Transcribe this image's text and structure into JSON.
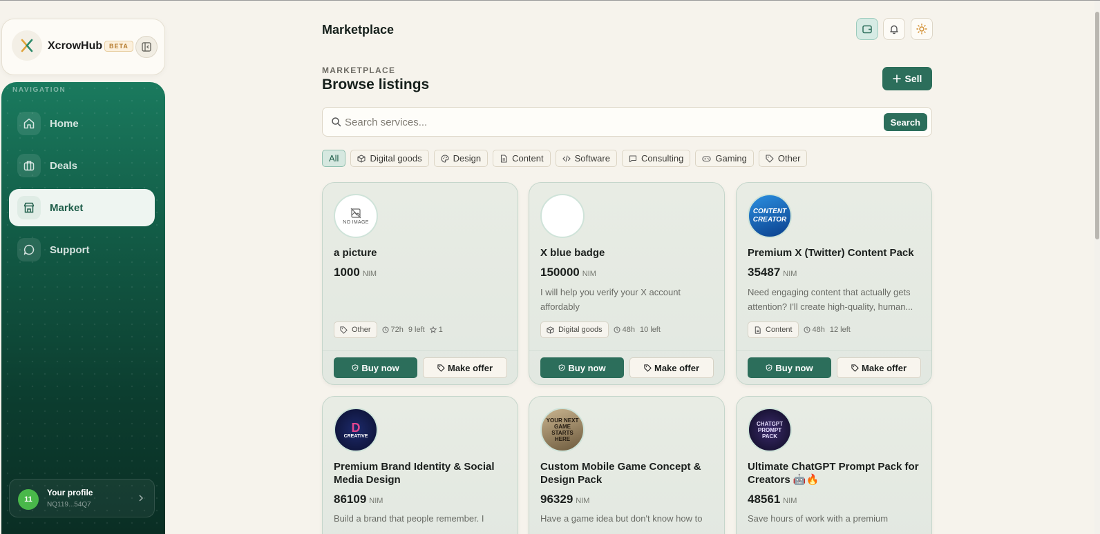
{
  "brand": {
    "name": "XcrowHub",
    "badge": "BETA"
  },
  "nav": {
    "heading": "NAVIGATION",
    "items": [
      {
        "label": "Home",
        "icon": "home-icon"
      },
      {
        "label": "Deals",
        "icon": "briefcase-icon"
      },
      {
        "label": "Market",
        "icon": "store-icon",
        "active": true
      },
      {
        "label": "Support",
        "icon": "chat-bubble-icon"
      }
    ]
  },
  "profile": {
    "initials": "11",
    "name": "Your profile",
    "address": "NQ119...54Q7"
  },
  "header": {
    "title": "Marketplace"
  },
  "section": {
    "eyebrow": "MARKETPLACE",
    "title": "Browse listings",
    "sell_label": "Sell"
  },
  "search": {
    "placeholder": "Search services...",
    "button": "Search"
  },
  "filters": [
    {
      "label": "All",
      "active": true
    },
    {
      "label": "Digital goods",
      "icon": "box-icon"
    },
    {
      "label": "Design",
      "icon": "palette-icon"
    },
    {
      "label": "Content",
      "icon": "document-icon"
    },
    {
      "label": "Software",
      "icon": "code-icon"
    },
    {
      "label": "Consulting",
      "icon": "message-icon"
    },
    {
      "label": "Gaming",
      "icon": "gamepad-icon"
    },
    {
      "label": "Other",
      "icon": "tag-icon"
    }
  ],
  "listings": [
    {
      "title": "a picture",
      "price": "1000",
      "unit": "NIM",
      "description": "",
      "category": "Other",
      "duration": "72h",
      "left": "9 left",
      "rating": "1",
      "image_text": "NO IMAGE"
    },
    {
      "title": "X blue badge",
      "price": "150000",
      "unit": "NIM",
      "description": "I will help you verify your X account affordably",
      "category": "Digital goods",
      "duration": "48h",
      "left": "10 left"
    },
    {
      "title": "Premium X (Twitter) Content Pack",
      "price": "35487",
      "unit": "NIM",
      "description": "Need engaging content that actually gets attention? I'll create high-quality, human...",
      "category": "Content",
      "duration": "48h",
      "left": "12 left",
      "image_text": "CONTENT CREATOR"
    },
    {
      "title": "Premium Brand Identity & Social Media Design",
      "price": "86109",
      "unit": "NIM",
      "description": "Build a brand that people remember. I",
      "image_text": "CREATIVE"
    },
    {
      "title": "Custom Mobile Game Concept & Design Pack",
      "price": "96329",
      "unit": "NIM",
      "description": "Have a game idea but don't know how to",
      "image_text": "YOUR NEXT GAME STARTS HERE"
    },
    {
      "title": "Ultimate ChatGPT Prompt Pack for Creators 🤖🔥",
      "price": "48561",
      "unit": "NIM",
      "description": "Save hours of work with a premium",
      "image_text": "CHATGPT PROMPT PACK"
    }
  ],
  "actions": {
    "buy": "Buy now",
    "offer": "Make offer"
  },
  "colors": {
    "accent": "#2c6e5b",
    "sidebar_top": "#1a7a5e",
    "sidebar_bottom": "#0a2e24",
    "background": "#f6f3ec"
  }
}
